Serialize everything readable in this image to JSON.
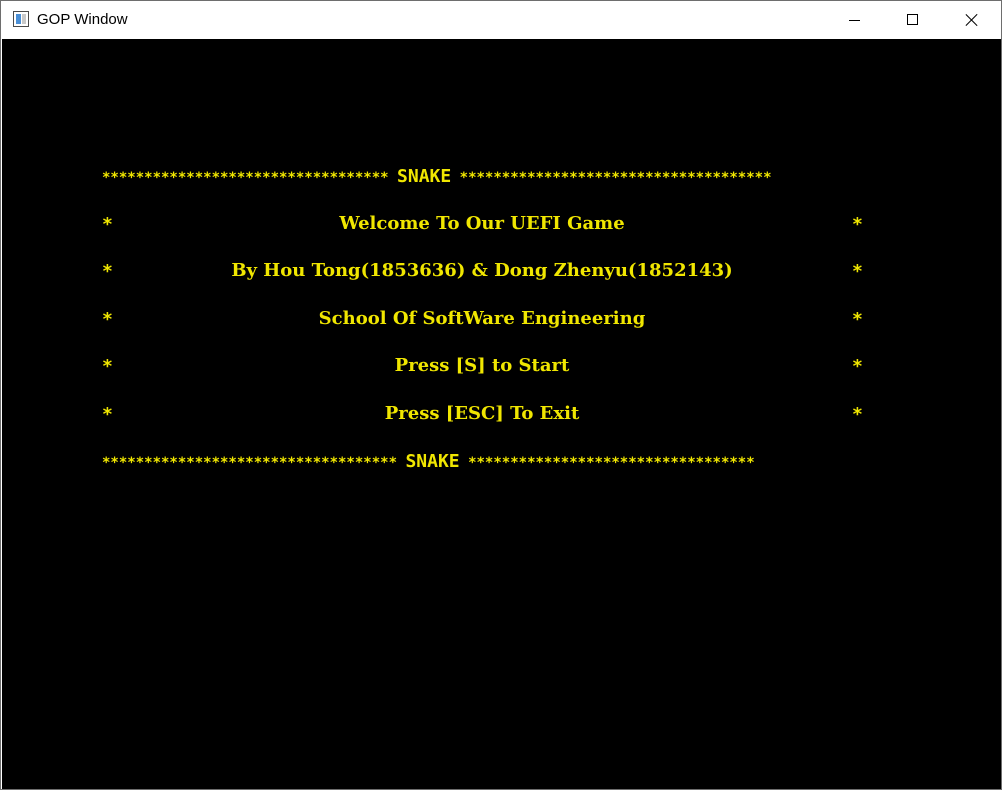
{
  "window": {
    "title": "GOP Window",
    "controls": {
      "minimize": "minimize",
      "maximize": "maximize",
      "close": "close"
    }
  },
  "screen": {
    "text_color": "#f0e600",
    "background": "#000000",
    "top_border": {
      "left_stars": "**********************************",
      "label": "SNAKE",
      "right_stars": "*************************************"
    },
    "bottom_border": {
      "left_stars": "***********************************",
      "label": "SNAKE",
      "right_stars": "**********************************"
    },
    "lines": [
      "Welcome To Our UEFI Game",
      "By Hou Tong(1853636) & Dong Zhenyu(1852143)",
      "School Of SoftWare Engineering",
      "Press [S] to Start",
      "Press [ESC] To Exit"
    ],
    "side_star": "*"
  }
}
